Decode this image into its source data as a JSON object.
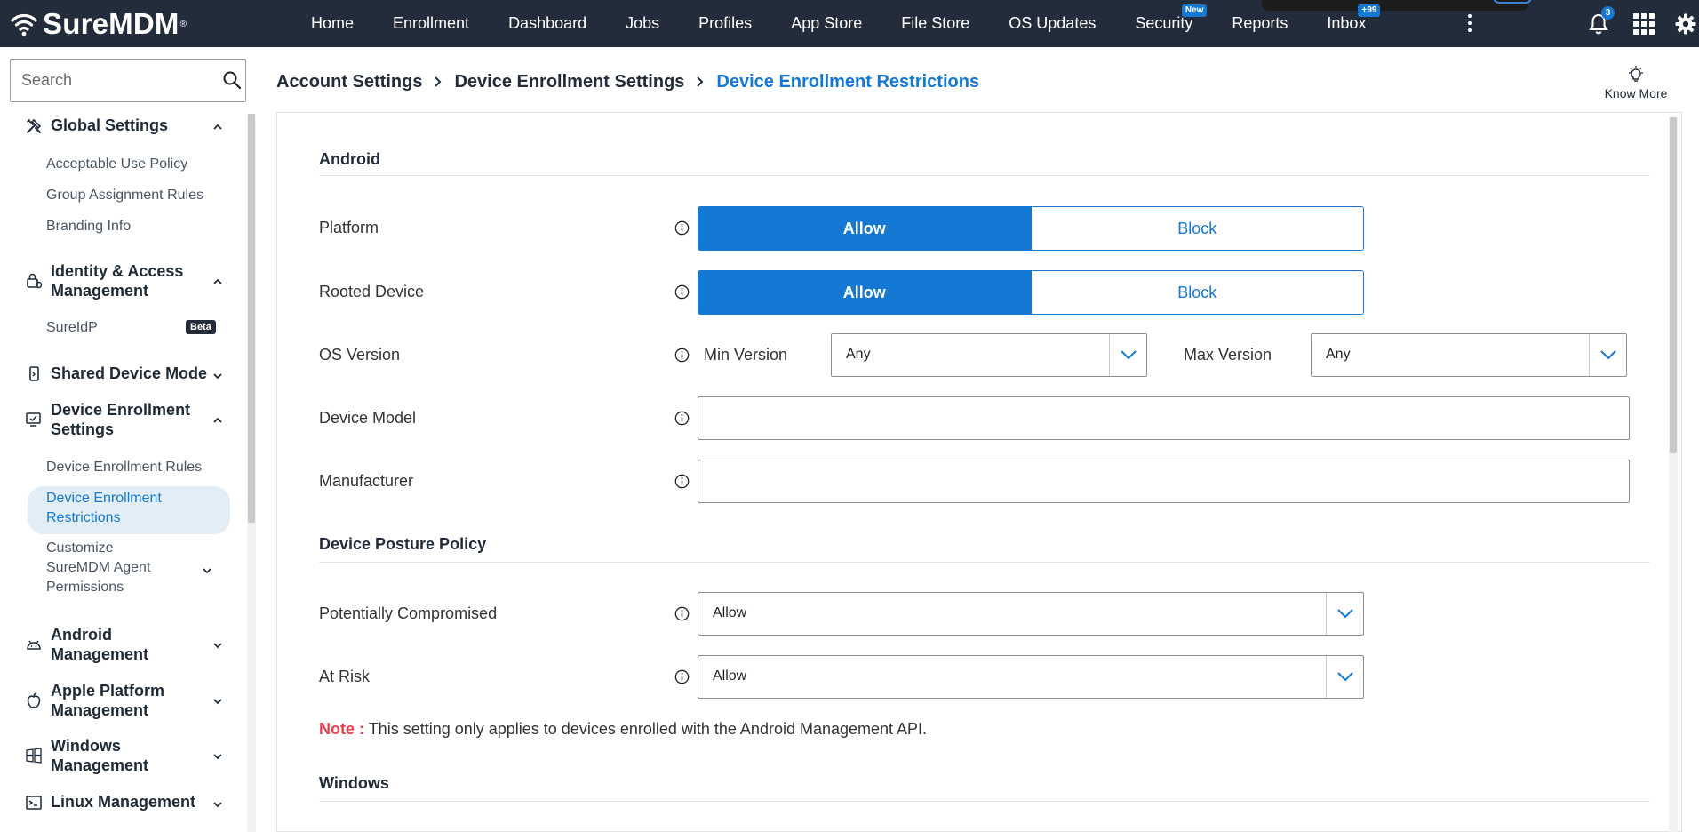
{
  "app": {
    "logo_text": "SureMDM",
    "logo_reg": "®"
  },
  "topnav": {
    "items": [
      {
        "label": "Home",
        "badge": null
      },
      {
        "label": "Enrollment",
        "badge": null
      },
      {
        "label": "Dashboard",
        "badge": null
      },
      {
        "label": "Jobs",
        "badge": null
      },
      {
        "label": "Profiles",
        "badge": null
      },
      {
        "label": "App Store",
        "badge": null
      },
      {
        "label": "File Store",
        "badge": null
      },
      {
        "label": "OS Updates",
        "badge": null
      },
      {
        "label": "Security",
        "badge": "New"
      },
      {
        "label": "Reports",
        "badge": null
      },
      {
        "label": "Inbox",
        "badge": "+99"
      }
    ],
    "notification_count": "3"
  },
  "sidebar": {
    "search_placeholder": "Search",
    "sections": {
      "global_settings": {
        "label": "Global Settings",
        "items": [
          "Acceptable Use Policy",
          "Group Assignment Rules",
          "Branding Info"
        ]
      },
      "identity": {
        "label": "Identity & Access Management",
        "items": [
          "SureIdP"
        ],
        "beta_badge": "Beta"
      },
      "shared_device": {
        "label": "Shared Device Mode"
      },
      "device_enrollment": {
        "label": "Device Enrollment Settings",
        "items": [
          "Device Enrollment Rules",
          "Device Enrollment Restrictions",
          "Customize SureMDM Agent Permissions"
        ]
      },
      "android": {
        "label": "Android Management"
      },
      "apple": {
        "label": "Apple Platform Management"
      },
      "windows": {
        "label": "Windows Management"
      },
      "linux": {
        "label": "Linux Management"
      }
    }
  },
  "breadcrumb": {
    "items": [
      "Account Settings",
      "Device Enrollment Settings",
      "Device Enrollment Restrictions"
    ]
  },
  "know_more": "Know More",
  "form": {
    "android_title": "Android",
    "platform": {
      "label": "Platform",
      "options": [
        "Allow",
        "Block"
      ],
      "selected": "Allow"
    },
    "rooted": {
      "label": "Rooted Device",
      "options": [
        "Allow",
        "Block"
      ],
      "selected": "Allow"
    },
    "os_version": {
      "label": "OS Version",
      "min_label": "Min Version",
      "min_value": "Any",
      "max_label": "Max Version",
      "max_value": "Any"
    },
    "device_model": {
      "label": "Device Model",
      "value": ""
    },
    "manufacturer": {
      "label": "Manufacturer",
      "value": ""
    },
    "posture_title": "Device Posture Policy",
    "potentially_compromised": {
      "label": "Potentially Compromised",
      "value": "Allow"
    },
    "at_risk": {
      "label": "At Risk",
      "value": "Allow"
    },
    "note_label": "Note :",
    "note_text": "This setting only applies to devices enrolled with the Android Management API.",
    "windows_title": "Windows"
  },
  "colors": {
    "topbar_bg": "#232c3b",
    "accent": "#1479d4",
    "note_red": "#e83f4e",
    "active_item_bg": "#e3edf6"
  }
}
